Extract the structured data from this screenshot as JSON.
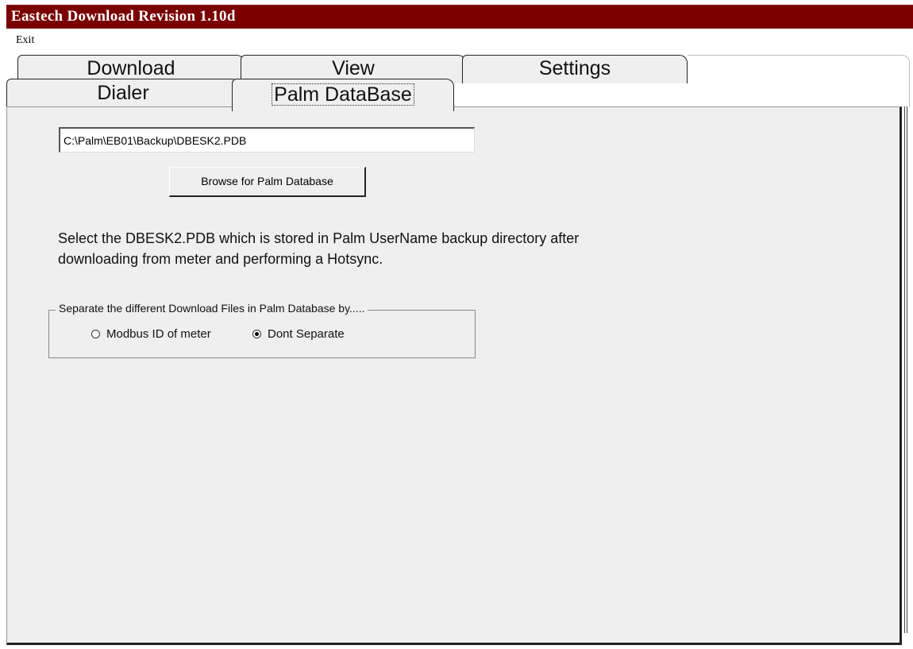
{
  "window": {
    "title": "Eastech Download Revision 1.10d"
  },
  "menu": {
    "exit_label": "Exit"
  },
  "tabs": {
    "download": "Download",
    "view": "View",
    "settings": "Settings",
    "dialer": "Dialer",
    "palm_database": "Palm DataBase"
  },
  "active_tab": "Palm DataBase",
  "palm_panel": {
    "path_value": "C:\\Palm\\EB01\\Backup\\DBESK2.PDB",
    "browse_label": "Browse for Palm Database",
    "instructions_line1": "Select the DBESK2.PDB which is stored in Palm UserName backup directory after",
    "instructions_line2": "downloading from meter and performing a Hotsync.",
    "group_label": "Separate the different Download Files in Palm Database by.....",
    "radio_modbus_label": "Modbus ID of meter",
    "radio_dont_label": "Dont Separate",
    "selected_option": "Dont Separate"
  },
  "colors": {
    "titlebar": "#7a0000",
    "panel": "#efefef"
  }
}
